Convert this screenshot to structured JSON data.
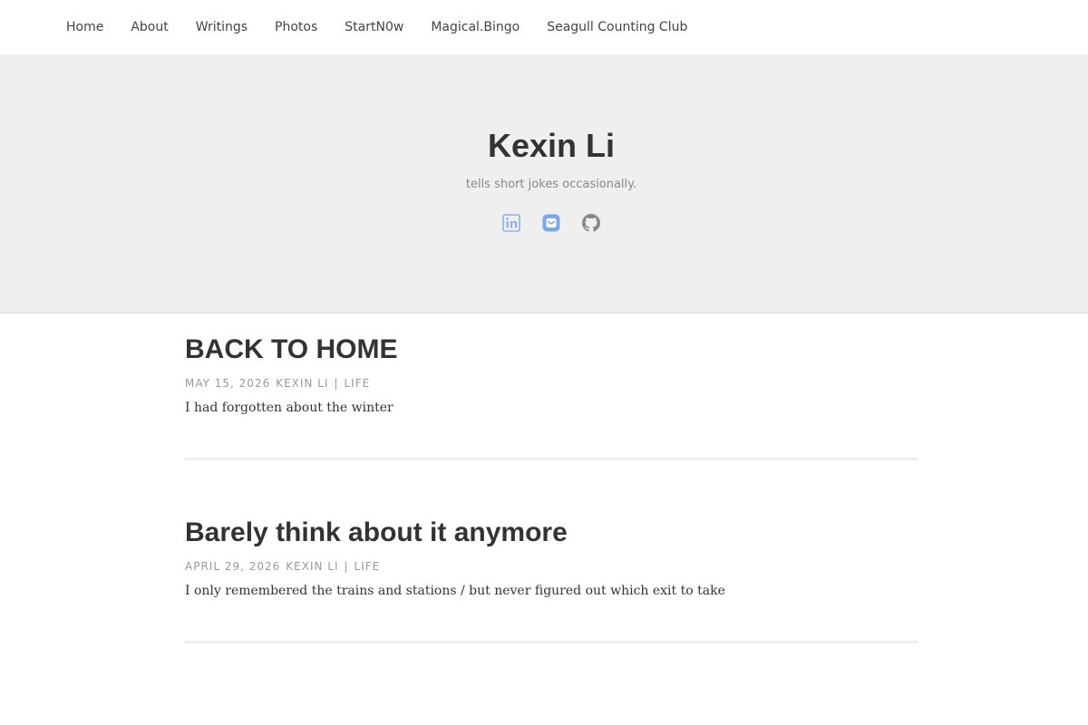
{
  "nav": {
    "items": [
      {
        "label": "Home"
      },
      {
        "label": "About"
      },
      {
        "label": "Writings"
      },
      {
        "label": "Photos"
      },
      {
        "label": "StartN0w"
      },
      {
        "label": "Magical.Bingo"
      },
      {
        "label": "Seagull Counting Club"
      }
    ]
  },
  "hero": {
    "title": "Kexin Li",
    "subtitle": "tells short jokes occasionally.",
    "social_icons": [
      "linkedin-icon",
      "email-icon",
      "github-icon"
    ]
  },
  "posts": [
    {
      "title": "BACK TO HOME",
      "date": "MAY 15, 2026",
      "author": "KEXIN LI",
      "category": "LIFE",
      "excerpt": "I had forgotten about the winter"
    },
    {
      "title": "Barely think about it anymore",
      "date": "APRIL 29, 2026",
      "author": "KEXIN LI",
      "category": "LIFE",
      "excerpt": "I only remembered the trains and stations / but never figured out which exit to take"
    }
  ],
  "colors": {
    "hero_bg": "#efefef",
    "linkedin": "#8fb2e6",
    "email": "#7aa7ee",
    "github": "#888888"
  }
}
